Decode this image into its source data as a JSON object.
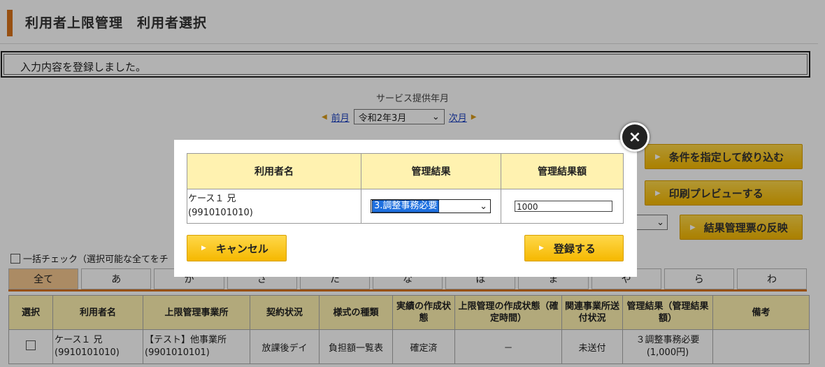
{
  "page_title": "利用者上限管理　利用者選択",
  "message": "入力内容を登録しました。",
  "service_month_label": "サービス提供年月",
  "prev_month": "前月",
  "next_month": "次月",
  "month_value": "令和2年3月",
  "buttons": {
    "filter": "条件を指定して絞り込む",
    "print_preview": "印刷プレビューする",
    "reflect": "結果管理票の反映"
  },
  "bulk_check": "一括チェック（選択可能な全てをチ",
  "kana_tabs": [
    "全て",
    "あ",
    "か",
    "さ",
    "た",
    "な",
    "は",
    "ま",
    "や",
    "ら",
    "わ"
  ],
  "list_headers": [
    "選択",
    "利用者名",
    "上限管理事業所",
    "契約状況",
    "様式の種類",
    "実績の作成状態",
    "上限管理の作成状態（確定時間）",
    "関連事業所送付状況",
    "管理結果（管理結果額）",
    "備考"
  ],
  "list_row": {
    "name": "ケース１ 兄",
    "name_id": "(9910101010)",
    "office": "【テスト】他事業所",
    "office_id": "(9901010101)",
    "contract": "放課後デイ",
    "form_type": "負担額一覧表",
    "record_state": "確定済",
    "limit_state": "－",
    "send_state": "未送付",
    "result": "３調整事務必要",
    "result_amount": "(1,000円)",
    "note": ""
  },
  "modal": {
    "headers": [
      "利用者名",
      "管理結果",
      "管理結果額"
    ],
    "name": "ケース１ 兄",
    "name_id": "(9910101010)",
    "result_value": "3.調整事務必要",
    "amount_value": "1000",
    "cancel": "キャンセル",
    "register": "登録する",
    "close_icon": "×"
  },
  "colors": {
    "accent": "#d9731a",
    "button": "#f5b800",
    "header_bg": "#fff2b0",
    "link": "#1a40c0"
  }
}
